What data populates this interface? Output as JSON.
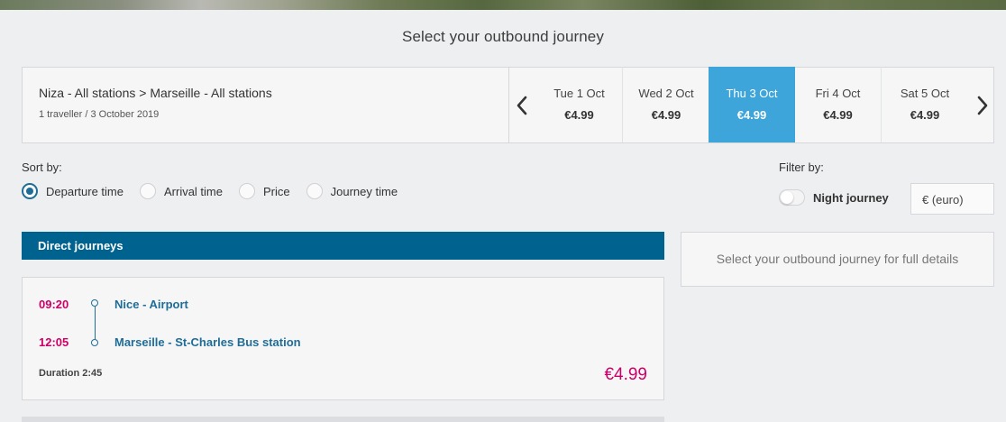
{
  "page": {
    "title": "Select your outbound journey"
  },
  "route": {
    "title": "Niza - All stations > Marseille - All stations",
    "subtitle": "1 traveller / 3 October 2019"
  },
  "dates": [
    {
      "label": "Tue 1 Oct",
      "price": "€4.99",
      "active": false
    },
    {
      "label": "Wed 2 Oct",
      "price": "€4.99",
      "active": false
    },
    {
      "label": "Thu 3 Oct",
      "price": "€4.99",
      "active": true
    },
    {
      "label": "Fri 4 Oct",
      "price": "€4.99",
      "active": false
    },
    {
      "label": "Sat 5 Oct",
      "price": "€4.99",
      "active": false
    }
  ],
  "sort": {
    "label": "Sort by:",
    "options": [
      "Departure time",
      "Arrival time",
      "Price",
      "Journey time"
    ],
    "selected": "Departure time"
  },
  "filter": {
    "label": "Filter by:",
    "night_journey_label": "Night journey",
    "night_journey_enabled": false,
    "currency": "€ (euro)"
  },
  "results": {
    "header": "Direct journeys",
    "details_hint": "Select your outbound journey for full details",
    "journeys": [
      {
        "departure_time": "09:20",
        "departure_station": "Nice - Airport",
        "arrival_time": "12:05",
        "arrival_station": "Marseille - St-Charles Bus station",
        "duration": "Duration 2:45",
        "price": "€4.99"
      }
    ]
  },
  "colors": {
    "accent_blue": "#3da5d9",
    "header_blue": "#00628f",
    "price_pink": "#cc0066",
    "station_blue": "#1f6d97"
  },
  "icons": {
    "prev": "chevron-left-icon",
    "next": "chevron-right-icon"
  }
}
